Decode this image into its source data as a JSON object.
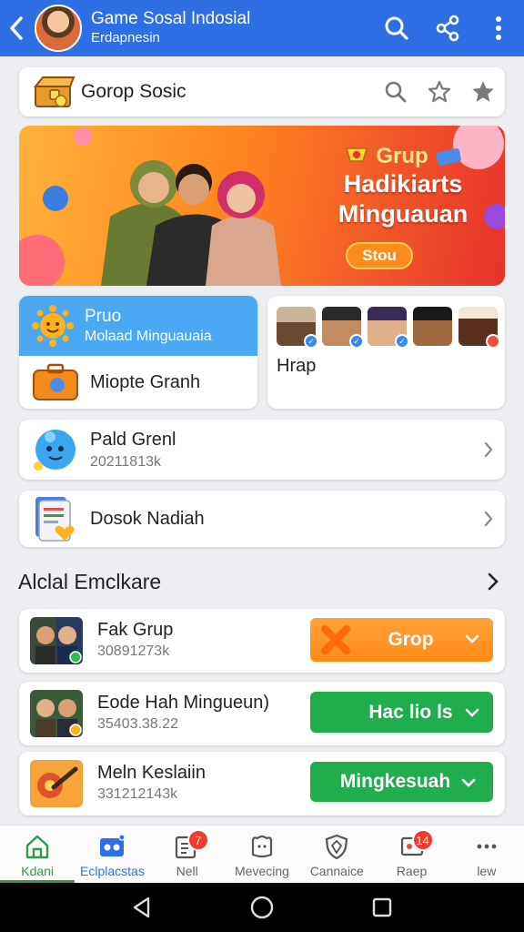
{
  "header": {
    "title": "Game Sosal Indosial",
    "subtitle": "Erdapnesin"
  },
  "search_row": {
    "label": "Gorop Sosic"
  },
  "banner": {
    "chip": "Grup",
    "line1": "Hadikiarts",
    "line2": "Minguauan",
    "button": "Stou"
  },
  "card_left": {
    "title": "Pruo",
    "subtitle": "Molaad Minguauaia",
    "bottom_label": "Miopte Granh"
  },
  "card_right": {
    "label": "Hrap"
  },
  "list": [
    {
      "title": "Pald Grenl",
      "sub": "20211813k"
    },
    {
      "title": "Dosok Nadiah",
      "sub": ""
    }
  ],
  "section": {
    "title": "Alclal Emclkare"
  },
  "groups": [
    {
      "title": "Fak Grup",
      "sub": "30891273k",
      "button": "Grop",
      "color": "#ff8a14"
    },
    {
      "title": "Eode Hah Mingueun)",
      "sub": "35403.38.22",
      "button": "Hac lio ls",
      "color": "#1fae4b"
    },
    {
      "title": "Meln Keslaiin",
      "sub": "331212143k",
      "button": "Mingkesuah",
      "color": "#1fae4b"
    }
  ],
  "bottom_nav": [
    {
      "label": "Kdani",
      "icon": "home-icon"
    },
    {
      "label": "Eclplacstas",
      "icon": "controller-icon"
    },
    {
      "label": "Nell",
      "icon": "notification-icon",
      "badge": "7"
    },
    {
      "label": "Mevecing",
      "icon": "puzzle-icon"
    },
    {
      "label": "Cannaice",
      "icon": "shield-icon"
    },
    {
      "label": "Raep",
      "icon": "message-icon",
      "badge": "14"
    },
    {
      "label": "lew",
      "icon": "more-icon"
    }
  ],
  "colors": {
    "header_bg": "#2f6fe6",
    "active_nav": "#2f9a4a",
    "orange_button": "#ff8a14",
    "green_button": "#1fae4b",
    "badge": "#f03c2e"
  }
}
